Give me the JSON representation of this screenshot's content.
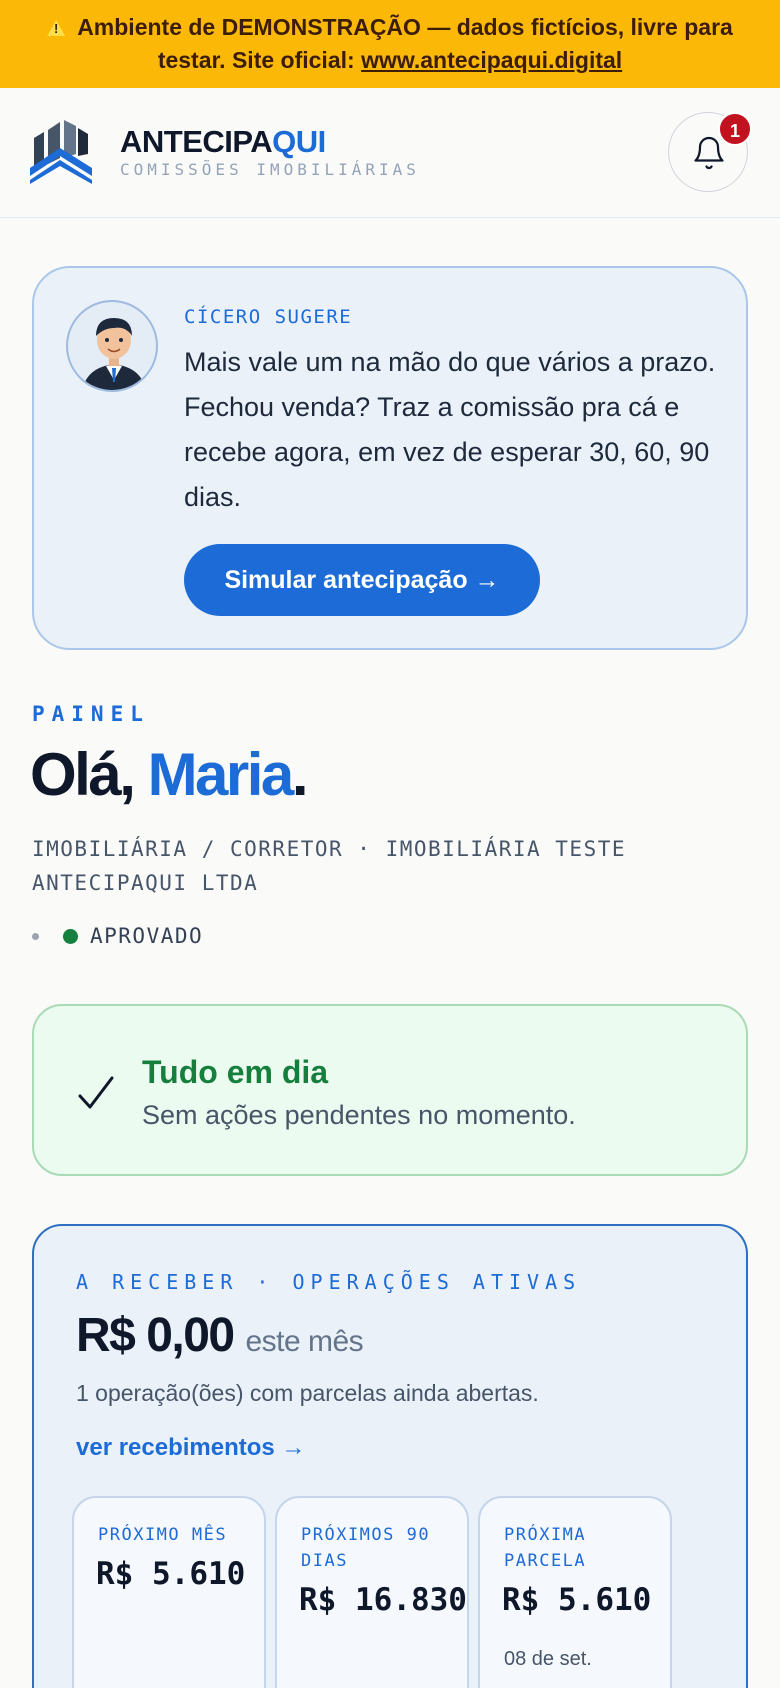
{
  "banner": {
    "icon": "warning-icon",
    "text": "Ambiente de DEMONSTRAÇÃO — dados fictícios, livre para testar. Site oficial:",
    "link": "www.antecipaqui.digital",
    "color": "#fbb806"
  },
  "header": {
    "brand_a": "ANTECIPA",
    "brand_b": "QUI",
    "tagline": "COMISSÕES IMOBILIÁRIAS",
    "notification_count": "1",
    "bell_icon": "bell-icon"
  },
  "cicero": {
    "label": "CÍCERO SUGERE",
    "message": "Mais vale um na mão do que vários a prazo. Fechou venda? Traz a comissão pra cá e recebe agora, em vez de esperar 30, 60, 90 dias.",
    "cta": "Simular antecipação →"
  },
  "dashboard": {
    "section": "PAINEL",
    "greeting_prefix": "Olá, ",
    "user_name": "Maria",
    "greeting_suffix": ".",
    "subtitle": "IMOBILIÁRIA / CORRETOR · IMOBILIÁRIA TESTE ANTECIPAQUI LTDA",
    "status": "APROVADO"
  },
  "alert": {
    "title": "Tudo em dia",
    "message": "Sem ações pendentes no momento."
  },
  "receivables": {
    "label": "A RECEBER · OPERAÇÕES ATIVAS",
    "amount": "R$ 0,00",
    "period": "este mês",
    "note": "1 operação(ões) com parcelas ainda abertas.",
    "link": "ver recebimentos →",
    "kpis": [
      {
        "label": "PRÓXIMO MÊS",
        "value": "R$ 5.610",
        "detail": ""
      },
      {
        "label": "PRÓXIMOS 90 DIAS",
        "value": "R$ 16.830",
        "detail": ""
      },
      {
        "label": "PRÓXIMA PARCELA",
        "value": "R$ 5.610",
        "detail": "08 de set."
      }
    ]
  }
}
